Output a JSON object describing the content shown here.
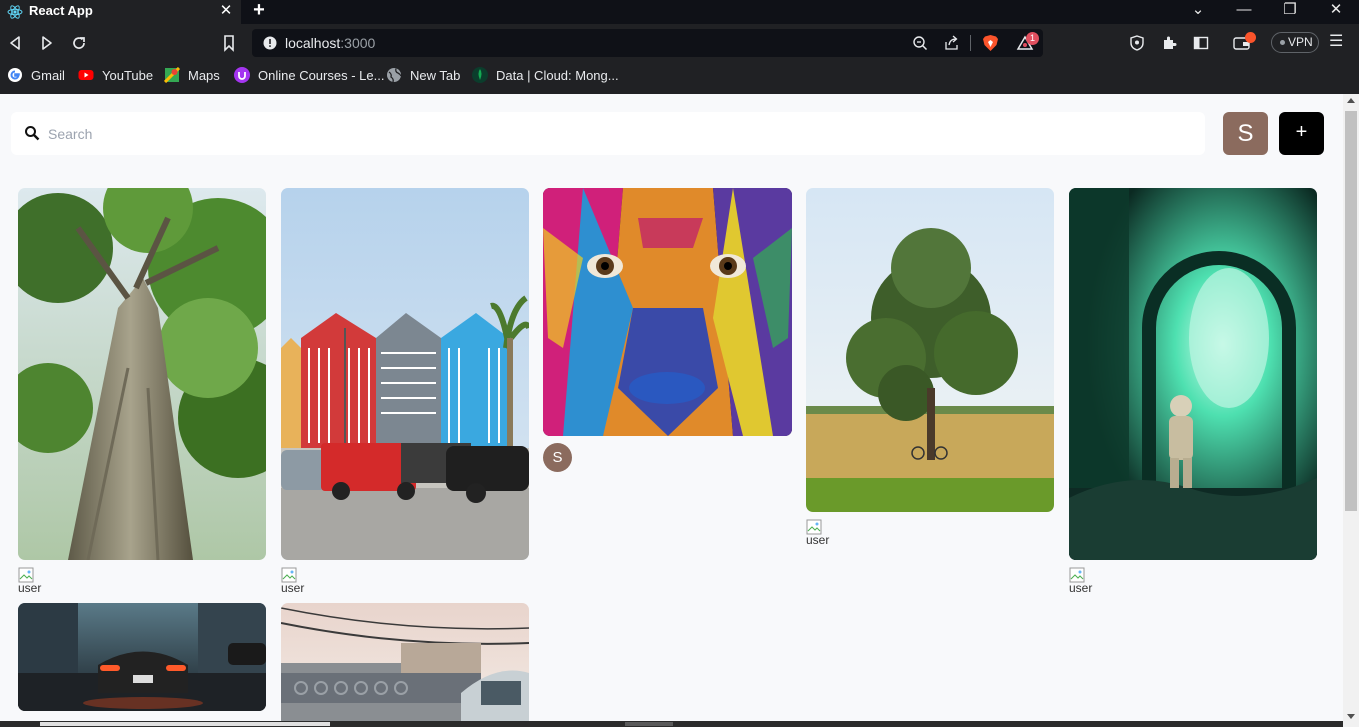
{
  "browser": {
    "tab_title": "React App",
    "tab_close_glyph": "✕",
    "new_tab_glyph": "+",
    "window_controls": {
      "dropdown": "⌄",
      "minimize": "—",
      "restore": "❐",
      "close": "✕"
    },
    "url_host": "localhost",
    "url_port": ":3000",
    "shields_badge_count": "1",
    "vpn_label": "VPN",
    "menu_glyph": "☰",
    "bookmarks": [
      {
        "label": "Gmail",
        "icon": "google-icon"
      },
      {
        "label": "YouTube",
        "icon": "youtube-icon"
      },
      {
        "label": "Maps",
        "icon": "maps-icon"
      },
      {
        "label": "Online Courses - Le...",
        "icon": "udemy-icon"
      },
      {
        "label": "New Tab",
        "icon": "globe-icon"
      },
      {
        "label": "Data | Cloud: Mong...",
        "icon": "mongodb-icon"
      }
    ]
  },
  "app": {
    "search_placeholder": "Search",
    "user_initial": "S",
    "add_button_glyph": "+",
    "pins": [
      {
        "image": "tall-tree-trunk",
        "user_alt": "user"
      },
      {
        "image": "colorful-beach-houses",
        "user_alt": "user"
      },
      {
        "image": "painted-face",
        "user_initial": "S"
      },
      {
        "image": "lone-tree-field",
        "user_alt": "user"
      },
      {
        "image": "astronaut-green-light",
        "user_alt": "user"
      },
      {
        "image": "sports-car-night"
      },
      {
        "image": "building-balcony"
      }
    ]
  },
  "colors": {
    "avatar": "#8b6b5e",
    "add_button": "#000000",
    "page_background": "#f8f9fb"
  }
}
